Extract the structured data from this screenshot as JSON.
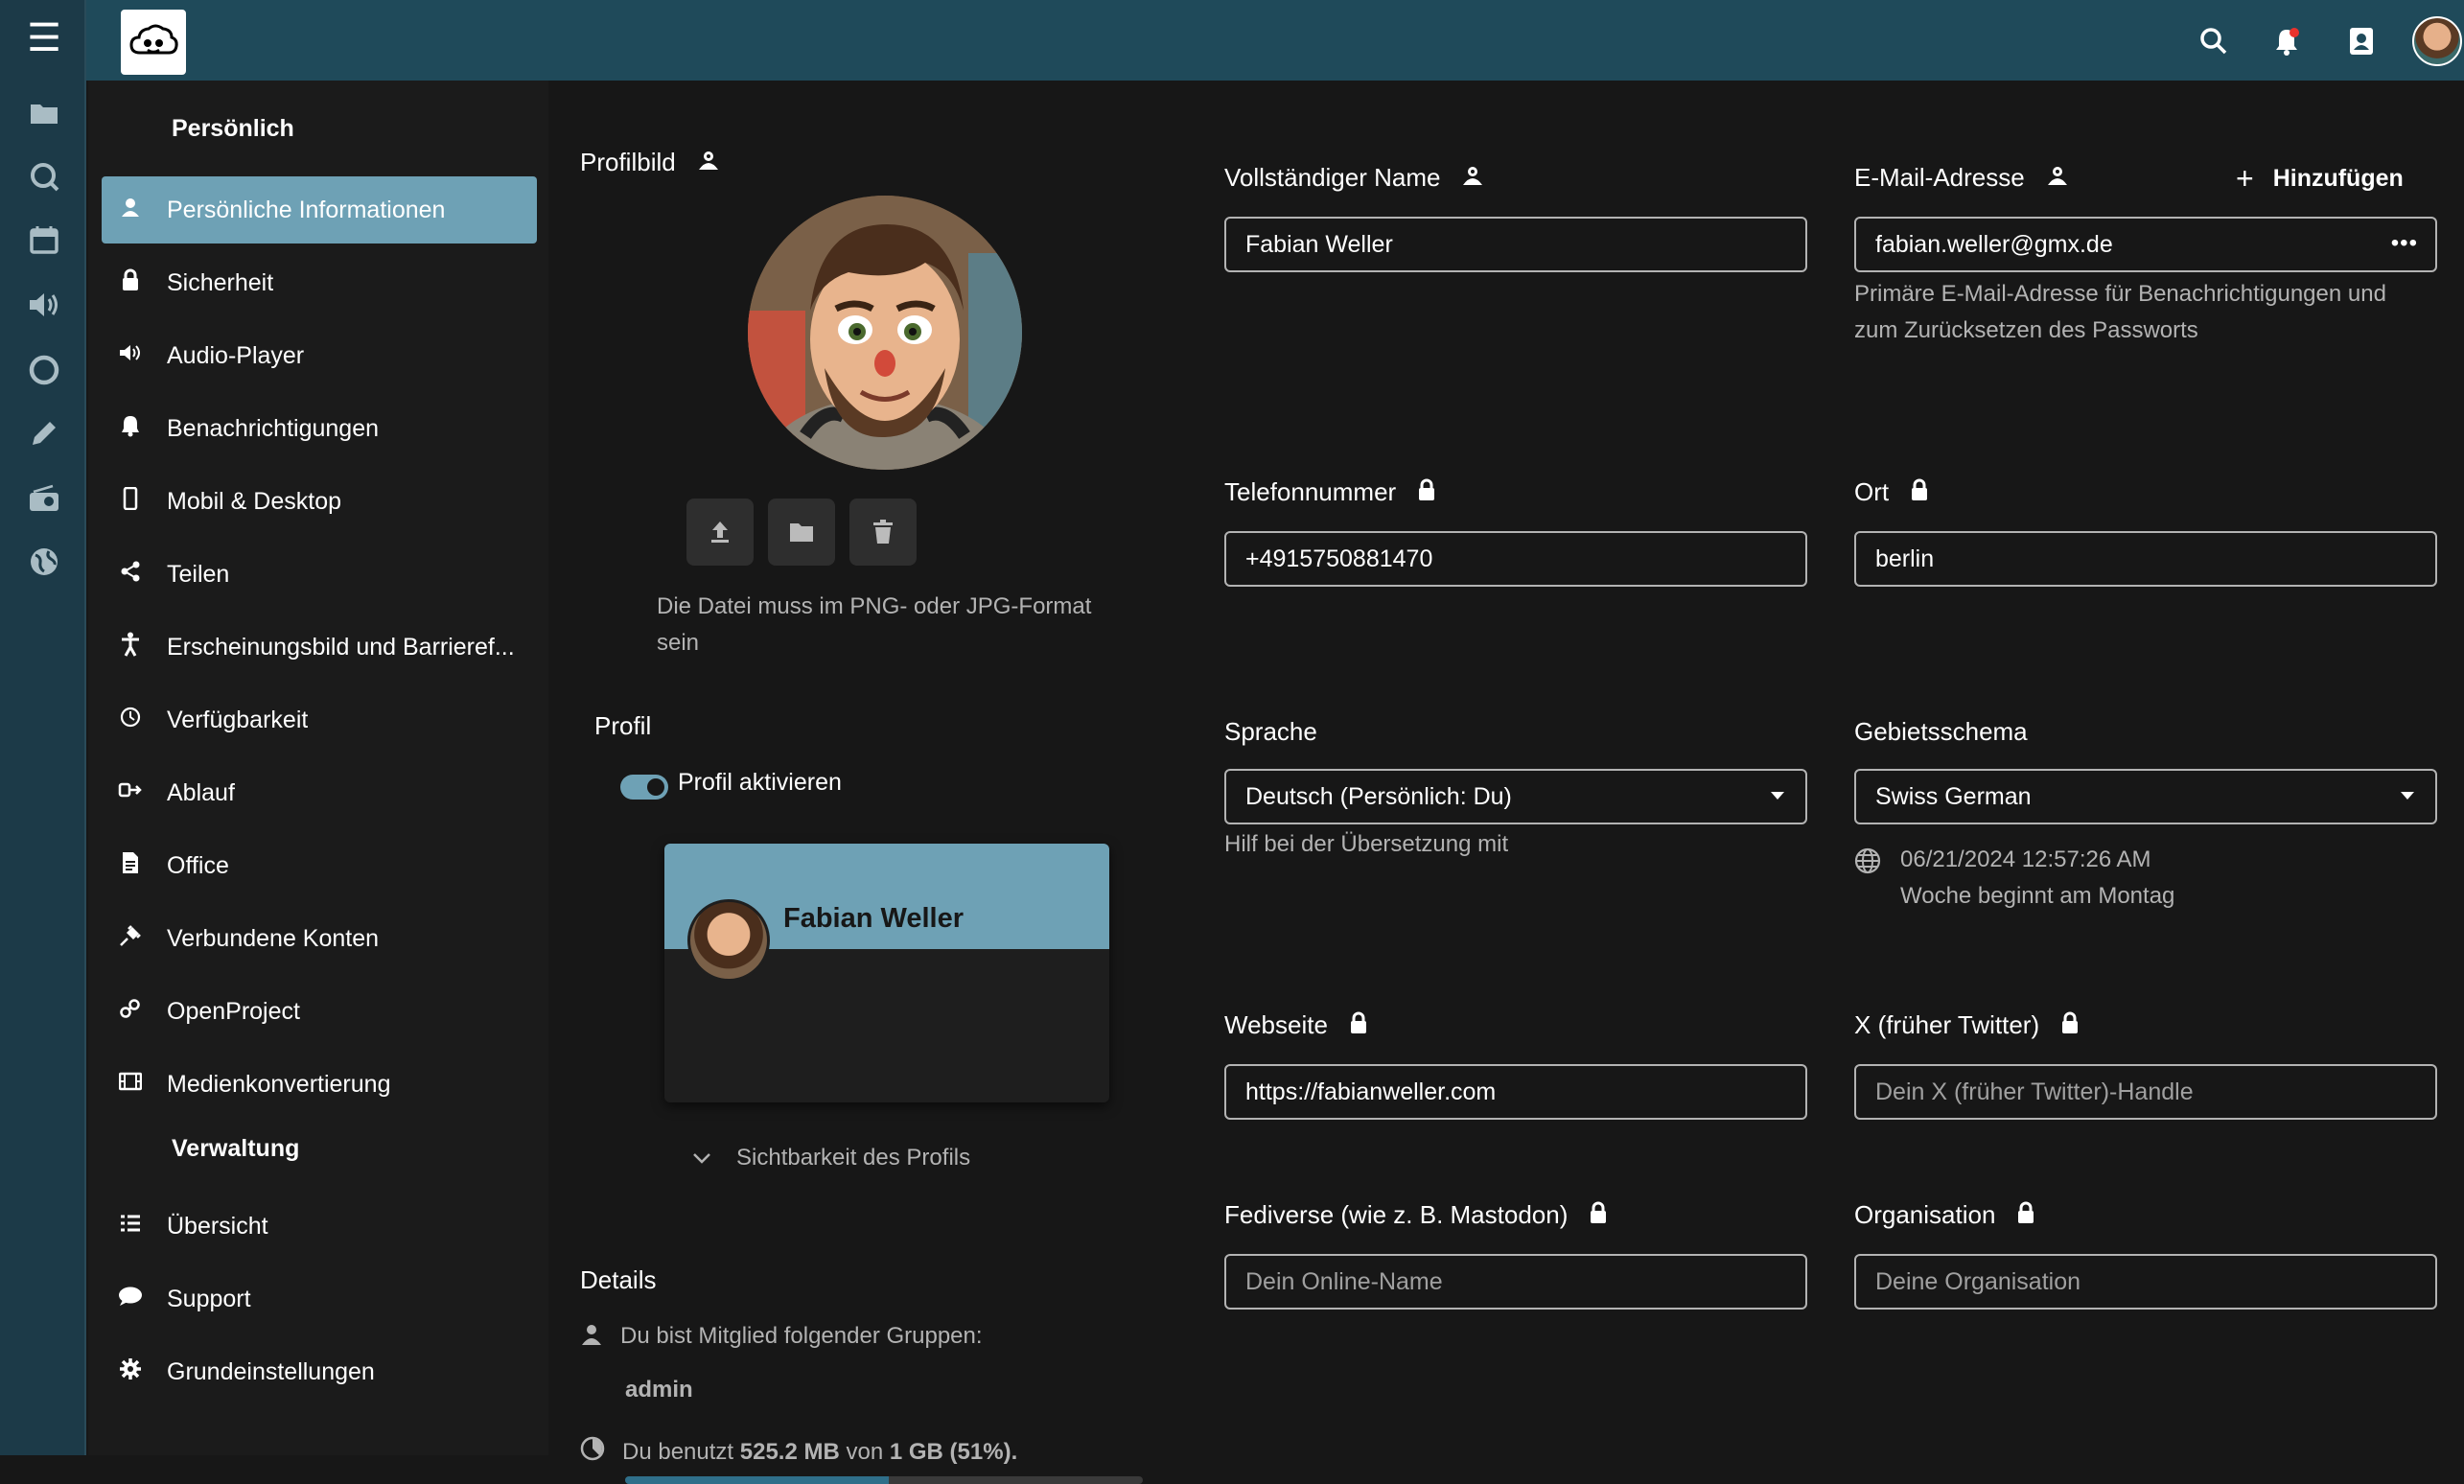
{
  "app": {
    "brand_color": "#1f4a5a",
    "accent_color": "#6ea1b5"
  },
  "topbar": {
    "icons": [
      "search-icon",
      "notification-bell-icon",
      "contacts-icon",
      "user-avatar"
    ]
  },
  "rail": {
    "icons": [
      "menu-icon",
      "files-icon",
      "search-icon",
      "calendar-icon",
      "audio-icon",
      "circle-icon",
      "notes-icon",
      "radio-icon",
      "globe-icon"
    ]
  },
  "sidebar": {
    "personal_title": "Persönlich",
    "admin_title": "Verwaltung",
    "personal_items": [
      {
        "label": "Persönliche Informationen",
        "icon": "user-icon"
      },
      {
        "label": "Sicherheit",
        "icon": "lock-icon"
      },
      {
        "label": "Audio-Player",
        "icon": "speaker-icon"
      },
      {
        "label": "Benachrichtigungen",
        "icon": "bell-icon"
      },
      {
        "label": "Mobil & Desktop",
        "icon": "phone-icon"
      },
      {
        "label": "Teilen",
        "icon": "share-icon"
      },
      {
        "label": "Erscheinungsbild und Barrieref...",
        "icon": "accessibility-icon"
      },
      {
        "label": "Verfügbarkeit",
        "icon": "clock-icon"
      },
      {
        "label": "Ablauf",
        "icon": "flow-icon"
      },
      {
        "label": "Office",
        "icon": "document-icon"
      },
      {
        "label": "Verbundene Konten",
        "icon": "plug-icon"
      },
      {
        "label": "OpenProject",
        "icon": "openproject-icon"
      },
      {
        "label": "Medienkonvertierung",
        "icon": "film-icon"
      }
    ],
    "admin_items": [
      {
        "label": "Übersicht",
        "icon": "list-icon"
      },
      {
        "label": "Support",
        "icon": "chat-icon"
      },
      {
        "label": "Grundeinstellungen",
        "icon": "gear-icon"
      }
    ]
  },
  "profile_picture": {
    "label": "Profilbild",
    "hint": "Die Datei muss im PNG- oder JPG-Format sein"
  },
  "profile": {
    "title": "Profil",
    "enable_label": "Profil aktivieren",
    "card_name": "Fabian Weller",
    "visibility_label": "Sichtbarkeit des Profils"
  },
  "details": {
    "title": "Details",
    "groups_text": "Du bist Mitglied folgender Gruppen:",
    "group_name": "admin",
    "usage_prefix": "Du benutzt",
    "usage_used": "525.2 MB",
    "usage_mid": "von",
    "usage_total": "1 GB",
    "usage_pct": "(51%).",
    "usage_fraction": 0.51
  },
  "fields": {
    "full_name": {
      "label": "Vollständiger Name",
      "value": "Fabian Weller"
    },
    "email": {
      "label": "E-Mail-Adresse",
      "add_label": "Hinzufügen",
      "value": "fabian.weller@gmx.de",
      "help": "Primäre E-Mail-Adresse für Benachrichtigungen und zum Zurücksetzen des Passworts"
    },
    "phone": {
      "label": "Telefonnummer",
      "value": "+4915750881470"
    },
    "city": {
      "label": "Ort",
      "value": "berlin"
    },
    "language": {
      "label": "Sprache",
      "value": "Deutsch (Persönlich: Du)",
      "help": "Hilf bei der Übersetzung mit"
    },
    "locale": {
      "label": "Gebietsschema",
      "value": "Swiss German",
      "time": "06/21/2024 12:57:26 AM",
      "week": "Woche beginnt am Montag"
    },
    "website": {
      "label": "Webseite",
      "value": "https://fabianweller.com"
    },
    "twitter": {
      "label": "X (früher Twitter)",
      "placeholder": "Dein X (früher Twitter)-Handle"
    },
    "fediverse": {
      "label": "Fediverse (wie z. B. Mastodon)",
      "placeholder": "Dein Online-Name"
    },
    "organisation": {
      "label": "Organisation",
      "placeholder": "Deine Organisation"
    }
  }
}
